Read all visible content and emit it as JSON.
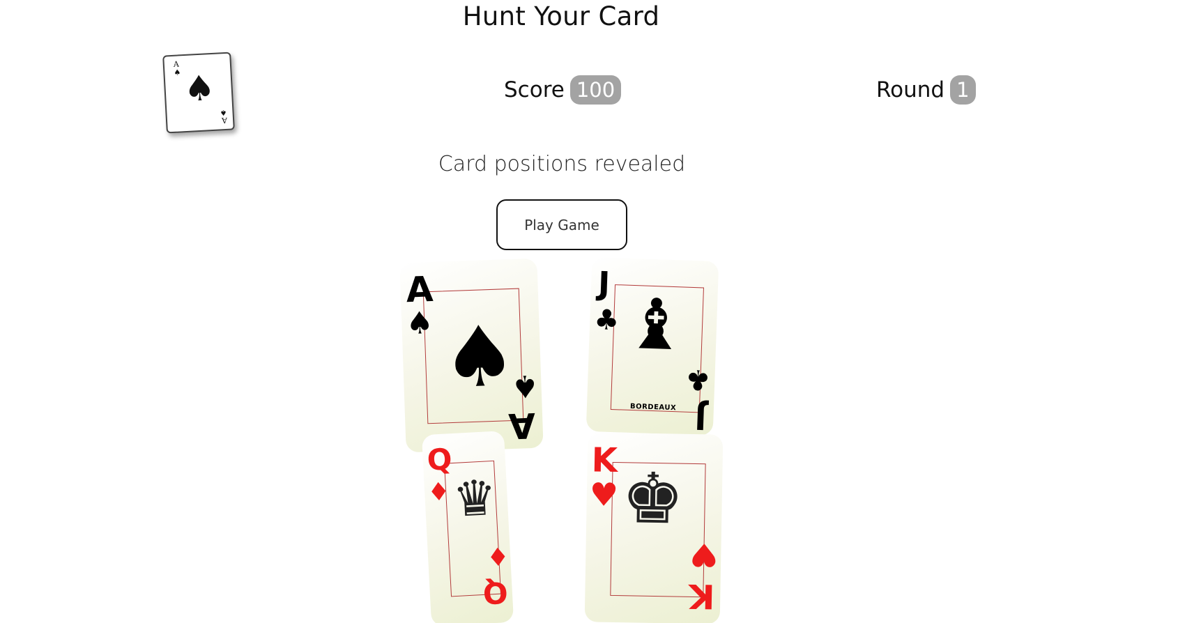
{
  "header": {
    "title": "Hunt Your Card"
  },
  "target_card": {
    "rank": "A",
    "suit": "♠"
  },
  "stats": {
    "score_label": "Score",
    "score_value": "100",
    "round_label": "Round",
    "round_value": "1"
  },
  "status": {
    "message": "Card positions revealed"
  },
  "actions": {
    "play_label": "Play Game"
  },
  "cards": [
    {
      "rank": "A",
      "suit": "♠",
      "color": "#000000",
      "center": "♠"
    },
    {
      "rank": "J",
      "suit": "♣",
      "color": "#000000",
      "figure": "♝",
      "sign": "BORDEAUX"
    },
    {
      "rank": "Q",
      "suit": "♦",
      "color": "#ee1c1c",
      "figure": "♛"
    },
    {
      "rank": "K",
      "suit": "♥",
      "color": "#ee1c1c",
      "figure": "♚"
    }
  ],
  "colors": {
    "badge": "#a3a3a3",
    "card_face": "#f5f5e6",
    "frame": "#b23a3a"
  }
}
